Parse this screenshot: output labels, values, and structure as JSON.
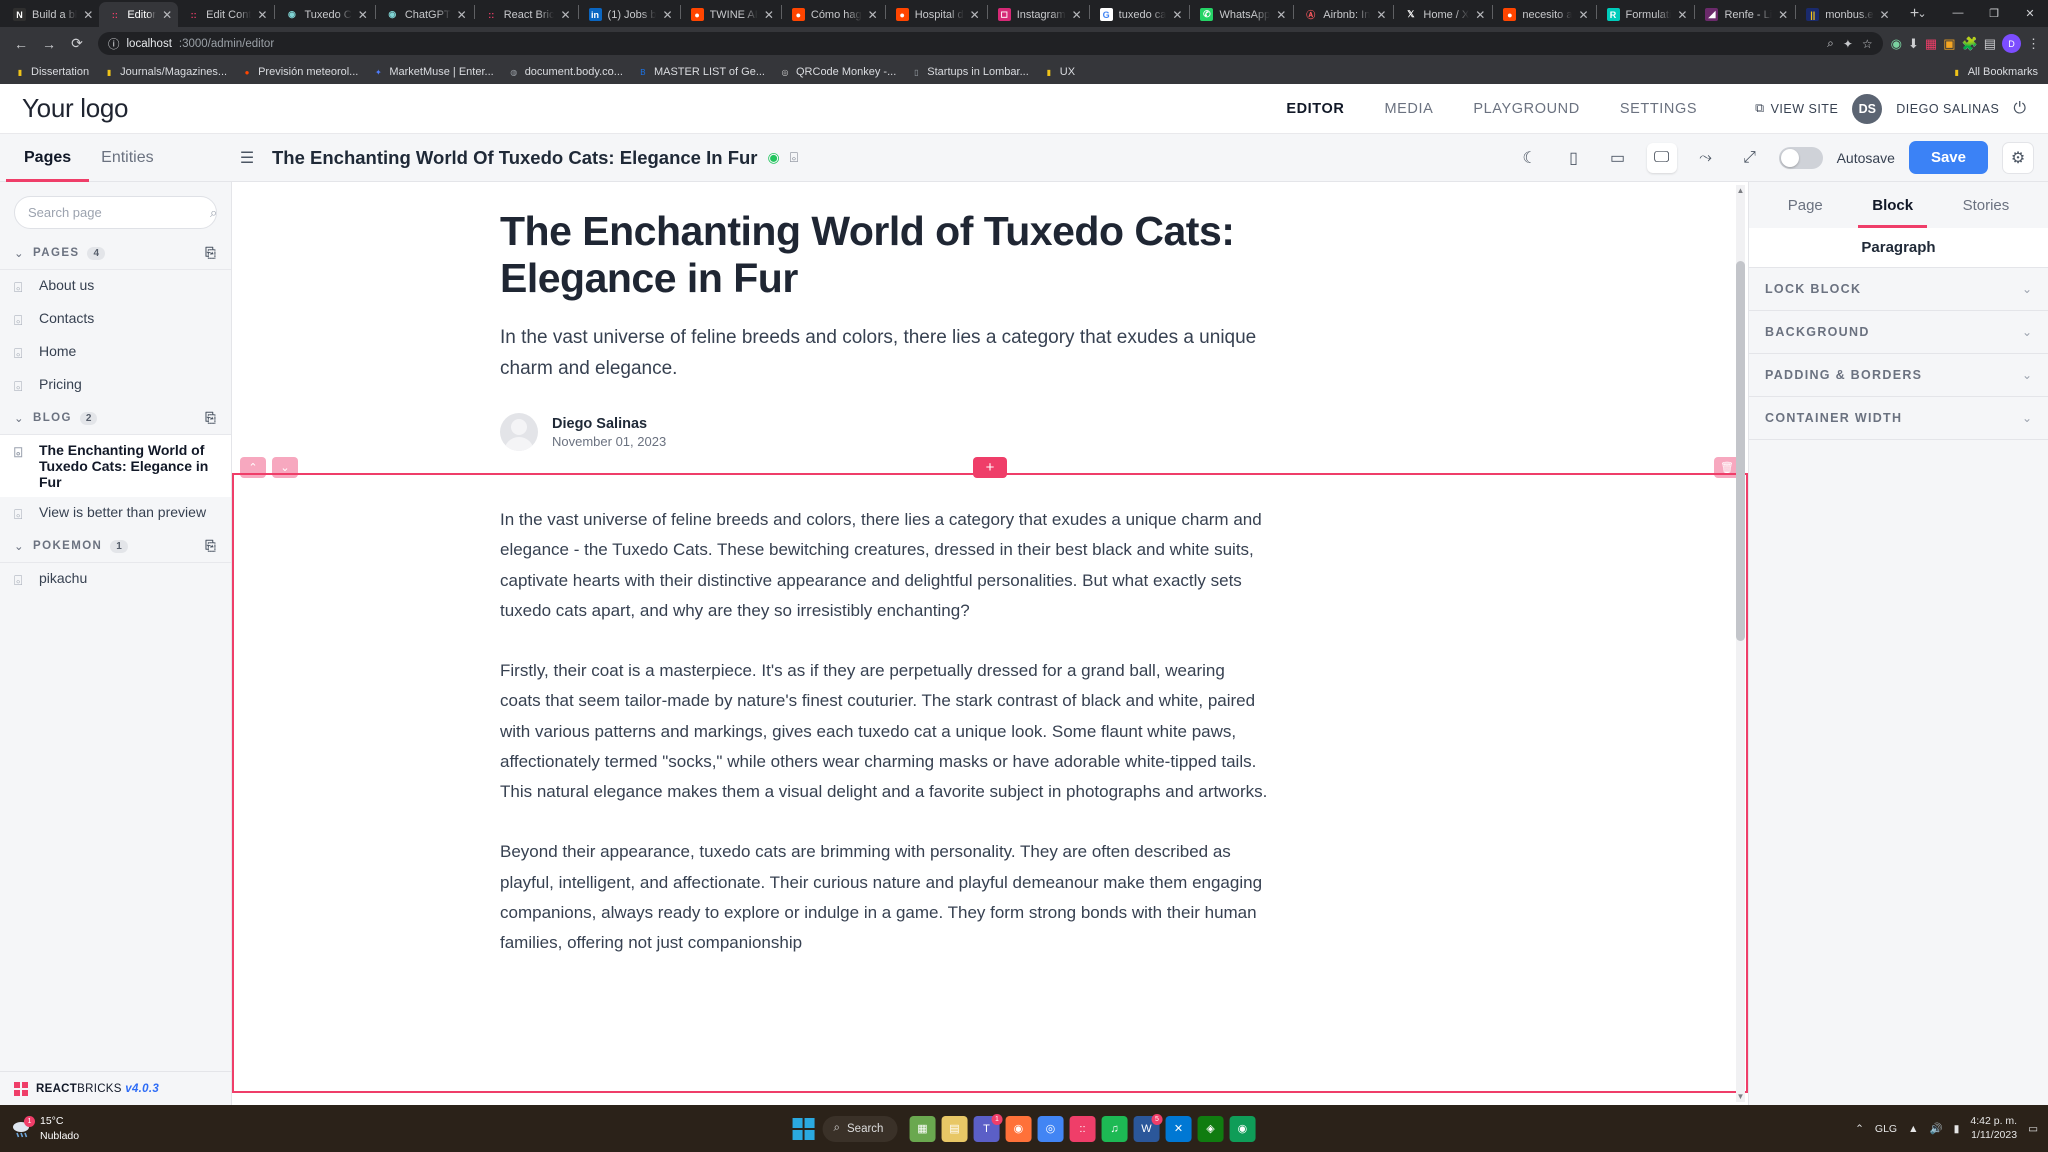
{
  "browser": {
    "tabs": [
      {
        "title": "Build a bl",
        "icon": "notion-icon",
        "color": "#ffffff",
        "bg": "#2f2f2f",
        "glyph": "N",
        "active": false
      },
      {
        "title": "Editor",
        "icon": "reactbricks-icon",
        "color": "#ef3e69",
        "bg": "transparent",
        "glyph": "::",
        "active": true
      },
      {
        "title": "Edit Cont",
        "icon": "reactbricks-icon",
        "color": "#ef3e69",
        "bg": "transparent",
        "glyph": "::",
        "active": false
      },
      {
        "title": "Tuxedo C",
        "icon": "globe-icon",
        "color": "#7fd4d4",
        "bg": "transparent",
        "glyph": "◉",
        "active": false
      },
      {
        "title": "ChatGPT",
        "icon": "chatgpt-icon",
        "color": "#7fd4d4",
        "bg": "transparent",
        "glyph": "◉",
        "active": false
      },
      {
        "title": "React Bric",
        "icon": "reactbricks-icon",
        "color": "#ef3e69",
        "bg": "transparent",
        "glyph": "::",
        "active": false
      },
      {
        "title": "(1) Jobs b",
        "icon": "linkedin-icon",
        "color": "#ffffff",
        "bg": "#0a66c2",
        "glyph": "in",
        "active": false
      },
      {
        "title": "TWINE AI",
        "icon": "reddit-icon",
        "color": "#ffffff",
        "bg": "#ff4500",
        "glyph": "●",
        "active": false
      },
      {
        "title": "Cómo hag",
        "icon": "reddit-icon",
        "color": "#ffffff",
        "bg": "#ff4500",
        "glyph": "●",
        "active": false
      },
      {
        "title": "Hospital d",
        "icon": "reddit-icon",
        "color": "#ffffff",
        "bg": "#ff4500",
        "glyph": "●",
        "active": false
      },
      {
        "title": "Instagram",
        "icon": "instagram-icon",
        "color": "#ffffff",
        "bg": "#d62976",
        "glyph": "◻",
        "active": false
      },
      {
        "title": "tuxedo ca",
        "icon": "google-icon",
        "color": "#4285f4",
        "bg": "#ffffff",
        "glyph": "G",
        "active": false
      },
      {
        "title": "WhatsApp",
        "icon": "whatsapp-icon",
        "color": "#ffffff",
        "bg": "#25d366",
        "glyph": "✆",
        "active": false
      },
      {
        "title": "Airbnb: In",
        "icon": "airbnb-icon",
        "color": "#ff5a5f",
        "bg": "transparent",
        "glyph": "Ⓐ",
        "active": false
      },
      {
        "title": "Home / X",
        "icon": "x-twitter-icon",
        "color": "#ffffff",
        "bg": "transparent",
        "glyph": "𝕏",
        "active": false
      },
      {
        "title": "necesito a",
        "icon": "reddit-icon",
        "color": "#ffffff",
        "bg": "#ff4500",
        "glyph": "●",
        "active": false
      },
      {
        "title": "Formulati",
        "icon": "researchgate-icon",
        "color": "#ffffff",
        "bg": "#00ccbb",
        "glyph": "R",
        "active": false
      },
      {
        "title": "Renfe - Li",
        "icon": "renfe-icon",
        "color": "#ffffff",
        "bg": "#6b2a6b",
        "glyph": "◢",
        "active": false
      },
      {
        "title": "monbus.e",
        "icon": "monbus-icon",
        "color": "#f5c518",
        "bg": "#1a2a6c",
        "glyph": "||",
        "active": false
      }
    ],
    "new_tab_label": "+",
    "close_glyph": "✕",
    "window_controls": {
      "dropdown": "⌄",
      "minimize": "—",
      "maximize": "❐",
      "close": "✕"
    },
    "nav": {
      "back": "←",
      "forward": "→",
      "reload": "⟳"
    },
    "url": {
      "info_icon": "ⓘ",
      "host": "localhost",
      "path": ":3000/admin/editor"
    },
    "omnibox_icons": [
      "search-icon",
      "sparkle-icon",
      "bookmark-star-icon"
    ],
    "toolbar_right_icons": [
      "extensions-icon",
      "profile-icon",
      "menu-icon"
    ],
    "profile_initial": "D",
    "bookmarks": [
      {
        "label": "Dissertation",
        "glyph": "▮",
        "color": "#f0c419"
      },
      {
        "label": "Journals/Magazines...",
        "glyph": "▮",
        "color": "#f0c419"
      },
      {
        "label": "Previsión meteorol...",
        "glyph": "●",
        "color": "#ff4500"
      },
      {
        "label": "MarketMuse | Enter...",
        "glyph": "✦",
        "color": "#4f7dff"
      },
      {
        "label": "document.body.co...",
        "glyph": "◍",
        "color": "#9aa0a6"
      },
      {
        "label": "MASTER LIST of Ge...",
        "glyph": "B",
        "color": "#1a73e8"
      },
      {
        "label": "QRCode Monkey -...",
        "glyph": "◎",
        "color": "#cccccc"
      },
      {
        "label": "Startups in Lombar...",
        "glyph": "▯",
        "color": "#9aa0a6"
      },
      {
        "label": "UX",
        "glyph": "▮",
        "color": "#f0c419"
      }
    ],
    "all_bookmarks_label": "All Bookmarks",
    "all_bookmarks_glyph": "▮"
  },
  "app": {
    "logo": "Your logo",
    "nav": [
      {
        "label": "EDITOR",
        "active": true
      },
      {
        "label": "MEDIA",
        "active": false
      },
      {
        "label": "PLAYGROUND",
        "active": false
      },
      {
        "label": "SETTINGS",
        "active": false
      }
    ],
    "view_site_label": "VIEW SITE",
    "view_site_icon": "external-link-icon",
    "avatar_initials": "DS",
    "user_name": "DIEGO SALINAS",
    "power_icon": "power-icon"
  },
  "editor_bar": {
    "hamburger_icon": "hamburger-icon",
    "title": "The Enchanting World Of Tuxedo Cats: Elegance In Fur",
    "visibility_icon": "eye-icon",
    "lock_icon": "unlock-icon",
    "device_icons": [
      {
        "name": "dark-mode-icon",
        "glyph": "☾",
        "selected": false
      },
      {
        "name": "mobile-icon",
        "glyph": "▯",
        "selected": false
      },
      {
        "name": "tablet-icon",
        "glyph": "▢",
        "selected": false
      },
      {
        "name": "desktop-icon",
        "glyph": "🖵",
        "selected": true
      },
      {
        "name": "share-icon",
        "glyph": "⇗",
        "selected": false
      },
      {
        "name": "fullscreen-icon",
        "glyph": "⤢",
        "selected": false
      }
    ],
    "autosave_label": "Autosave",
    "autosave_on": false,
    "save_label": "Save",
    "settings_icon": "gear-icon"
  },
  "sidebar": {
    "tabs": [
      {
        "label": "Pages",
        "active": true
      },
      {
        "label": "Entities",
        "active": false
      }
    ],
    "search_placeholder": "Search page",
    "search_value": "",
    "search_icon": "search-icon",
    "groups": [
      {
        "label": "PAGES",
        "count": "4",
        "chevron": "⌄",
        "add_icon": "add-page-icon",
        "items": [
          {
            "label": "About us",
            "active": false
          },
          {
            "label": "Contacts",
            "active": false
          },
          {
            "label": "Home",
            "active": false
          },
          {
            "label": "Pricing",
            "active": false
          }
        ]
      },
      {
        "label": "BLOG",
        "count": "2",
        "chevron": "⌄",
        "add_icon": "add-page-icon",
        "items": [
          {
            "label": "The Enchanting World of Tuxedo Cats: Elegance in Fur",
            "active": true
          },
          {
            "label": "View is better than preview",
            "active": false
          }
        ]
      },
      {
        "label": "POKEMON",
        "count": "1",
        "chevron": "⌄",
        "add_icon": "add-page-icon",
        "items": [
          {
            "label": "pikachu",
            "active": false
          }
        ]
      }
    ],
    "footer": {
      "brand_bold": "REACT",
      "brand_rest": "BRICKS",
      "version": "v4.0.3"
    }
  },
  "article": {
    "title": "The Enchanting World of Tuxedo Cats: Elegance in Fur",
    "subtitle": "In the vast universe of feline breeds and colors, there lies a category that exudes a unique charm and elegance.",
    "author": "Diego Salinas",
    "date": "November 01, 2023",
    "block_controls": {
      "up": "⌃",
      "down": "⌄",
      "add": "+",
      "delete": "🗑"
    },
    "paragraphs": [
      "In the vast universe of feline breeds and colors, there lies a category that exudes a unique charm and elegance - the Tuxedo Cats. These bewitching creatures, dressed in their best black and white suits, captivate hearts with their distinctive appearance and delightful personalities. But what exactly sets tuxedo cats apart, and why are they so irresistibly enchanting?",
      "Firstly, their coat is a masterpiece. It's as if they are perpetually dressed for a grand ball, wearing coats that seem tailor-made by nature's finest couturier. The stark contrast of black and white, paired with various patterns and markings, gives each tuxedo cat a unique look. Some flaunt white paws, affectionately termed \"socks,\" while others wear charming masks or have adorable white-tipped tails. This natural elegance makes them a visual delight and a favorite subject in photographs and artworks.",
      "Beyond their appearance, tuxedo cats are brimming with personality. They are often described as playful, intelligent, and affectionate. Their curious nature and playful demeanour make them engaging companions, always ready to explore or indulge in a game. They form strong bonds with their human families, offering not just companionship"
    ]
  },
  "right_panel": {
    "tabs": [
      {
        "label": "Page",
        "active": false
      },
      {
        "label": "Block",
        "active": true
      },
      {
        "label": "Stories",
        "active": false
      }
    ],
    "block_name": "Paragraph",
    "sections": [
      {
        "label": "LOCK BLOCK",
        "chevron": "⌄"
      },
      {
        "label": "BACKGROUND",
        "chevron": "⌄"
      },
      {
        "label": "PADDING & BORDERS",
        "chevron": "⌄"
      },
      {
        "label": "CONTAINER WIDTH",
        "chevron": "⌄"
      }
    ]
  },
  "taskbar": {
    "weather": {
      "temp": "15°C",
      "desc": "Nublado",
      "icon": "rain-cloud-icon",
      "badge": "1"
    },
    "start_icon": "windows-start-icon",
    "search_placeholder": "Search",
    "search_icon": "search-icon",
    "apps": [
      {
        "name": "widgets-icon",
        "glyph": "▦",
        "color": "#6aa84f",
        "badge": ""
      },
      {
        "name": "file-explorer-icon",
        "glyph": "▤",
        "color": "#e8c766",
        "badge": ""
      },
      {
        "name": "teams-icon",
        "glyph": "T",
        "color": "#5b5fc7",
        "badge": "1"
      },
      {
        "name": "firefox-icon",
        "glyph": "◉",
        "color": "#ff7139",
        "badge": ""
      },
      {
        "name": "chrome-icon",
        "glyph": "◎",
        "color": "#4285f4",
        "badge": ""
      },
      {
        "name": "reactbricks-icon",
        "glyph": "::",
        "color": "#ef3e69",
        "badge": ""
      },
      {
        "name": "spotify-icon",
        "glyph": "♫",
        "color": "#1db954",
        "badge": ""
      },
      {
        "name": "word-icon",
        "glyph": "W",
        "color": "#2b579a",
        "badge": "5"
      },
      {
        "name": "vscode-icon",
        "glyph": "✕",
        "color": "#0078d4",
        "badge": ""
      },
      {
        "name": "xbox-icon",
        "glyph": "◈",
        "color": "#107c10",
        "badge": ""
      },
      {
        "name": "edge-icon",
        "glyph": "◉",
        "color": "#0f9d58",
        "badge": ""
      }
    ],
    "tray": {
      "chevron": "⌃",
      "lang": "GLG",
      "wifi_icon": "wifi-icon",
      "volume_icon": "volume-icon",
      "battery": "100"
    },
    "clock": {
      "time": "4:42 p. m.",
      "date": "1/11/2023"
    },
    "notification_icon": "notification-icon"
  }
}
